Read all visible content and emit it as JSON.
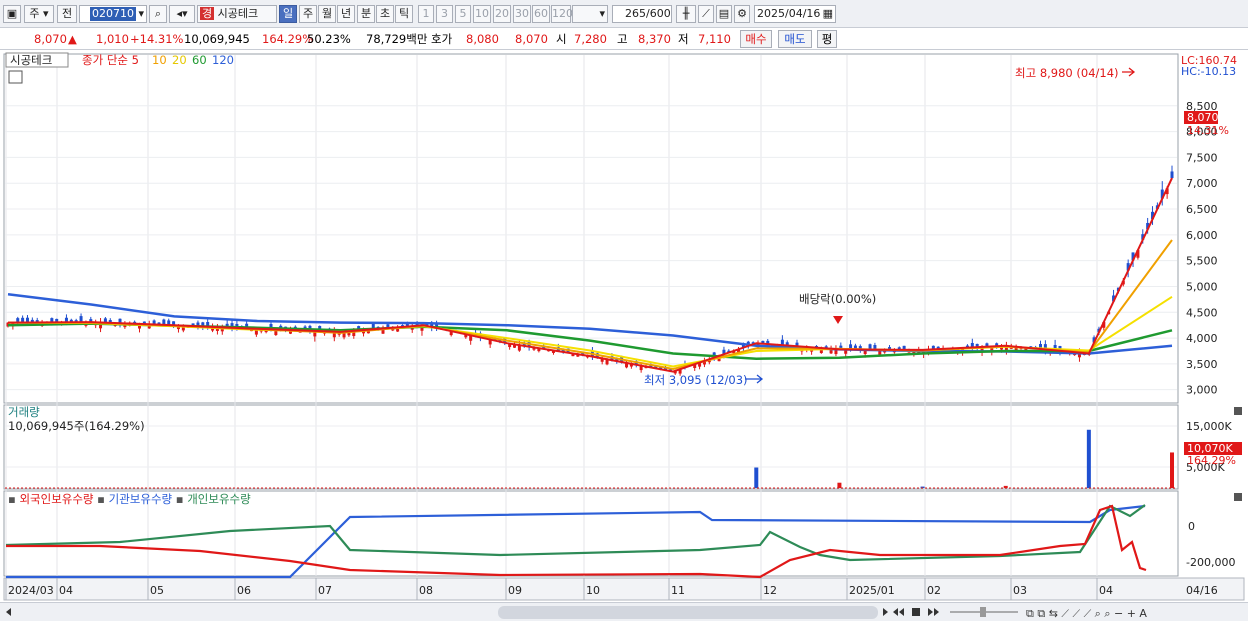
{
  "toolbar": {
    "period_label": "주",
    "prev_label": "전",
    "code": "020710",
    "stock_name": "시공테크",
    "stock_badge": "경",
    "timeframes": [
      "일",
      "주",
      "월",
      "년",
      "분",
      "초",
      "틱"
    ],
    "intervals": [
      "1",
      "3",
      "5",
      "10",
      "20",
      "30",
      "60",
      "120"
    ],
    "count": "265",
    "count_max": "/600",
    "date": "2025/04/16"
  },
  "quote": {
    "price": "8,070",
    "change_mark": "▲",
    "change": "1,010",
    "change_pct": "+14.31%",
    "volume": "10,069,945",
    "volume_pct": "164.29%",
    "ratio": "50.23%",
    "amount": "78,729백만",
    "ask_label": "호가",
    "ask1": "8,080",
    "ask2": "8,070",
    "open_label": "시",
    "open": "7,280",
    "high_label": "고",
    "high": "8,370",
    "low_label": "저",
    "low": "7,110",
    "buy_label": "매수",
    "sell_label": "매도",
    "flat_label": "평"
  },
  "price_panel": {
    "name_tag": "시공테크",
    "legend_prefix": "종가 단순 5",
    "ma_labels": [
      "10",
      "20",
      "60",
      "120"
    ],
    "lc": "LC:160.74",
    "hc": "HC:-10.13",
    "last_price": "8,070",
    "last_pct": "14.31%",
    "high_note": "최고 8,980 (04/14)",
    "low_note": "최저 3,095 (12/03)",
    "dividend_note": "배당락(0.00%)",
    "y_ticks": [
      "8,500",
      "8,000",
      "7,500",
      "7,000",
      "6,500",
      "6,000",
      "5,500",
      "5,000",
      "4,500",
      "4,000",
      "3,500",
      "3,000"
    ]
  },
  "volume_panel": {
    "title": "거래량",
    "value": "10,069,945주(164.29%)",
    "y_ticks": [
      "15,000K",
      "5,000K"
    ],
    "last_value": "10,070K",
    "last_pct": "164.29%"
  },
  "holdings_panel": {
    "legend": [
      "외국인보유수량",
      "기관보유수량",
      "개인보유수량"
    ],
    "y_ticks": [
      "0",
      "-200,000"
    ]
  },
  "x_axis": {
    "labels": [
      "2024/03",
      "04",
      "05",
      "06",
      "07",
      "08",
      "09",
      "10",
      "11",
      "12",
      "2025/01",
      "02",
      "03",
      "04"
    ],
    "right_label": "04/16"
  },
  "colors": {
    "ma5": "#e01818",
    "ma10": "#f0a000",
    "ma20": "#f5e000",
    "ma60": "#1f9a30",
    "ma120": "#2d5fd8",
    "up": "#e01818",
    "down": "#1f4fd0",
    "foreign": "#e01818",
    "institution": "#2d5fd8",
    "individual": "#2e8b57"
  },
  "chart_data": {
    "type": "line",
    "ylim": [
      2800,
      9000
    ],
    "x": [
      "2024/03",
      "04",
      "05",
      "06",
      "07",
      "08",
      "09",
      "10",
      "11",
      "12",
      "2025/01",
      "02",
      "03",
      "04",
      "04/16"
    ],
    "series": [
      {
        "name": "5",
        "values": [
          4300,
          4310,
          4250,
          4180,
          4120,
          4250,
          3900,
          3650,
          3350,
          3900,
          3780,
          3770,
          3850,
          3700,
          7100
        ]
      },
      {
        "name": "10",
        "values": [
          4300,
          4300,
          4240,
          4170,
          4100,
          4240,
          3950,
          3700,
          3400,
          3800,
          3790,
          3760,
          3840,
          3720,
          5900
        ]
      },
      {
        "name": "20",
        "values": [
          4300,
          4290,
          4230,
          4160,
          4120,
          4230,
          4000,
          3760,
          3450,
          3750,
          3790,
          3760,
          3830,
          3760,
          4800
        ]
      },
      {
        "name": "60",
        "values": [
          4250,
          4280,
          4240,
          4200,
          4150,
          4220,
          4150,
          3950,
          3700,
          3600,
          3620,
          3700,
          3750,
          3750,
          4150
        ]
      },
      {
        "name": "120",
        "values": [
          4850,
          4650,
          4420,
          4330,
          4300,
          4290,
          4250,
          4180,
          4050,
          3850,
          3780,
          3750,
          3740,
          3700,
          3850
        ]
      }
    ],
    "volume_values_k": [
      0,
      0,
      0,
      0,
      0,
      0,
      0,
      0,
      0,
      5800,
      1500,
      400,
      600,
      16500,
      10070
    ]
  }
}
